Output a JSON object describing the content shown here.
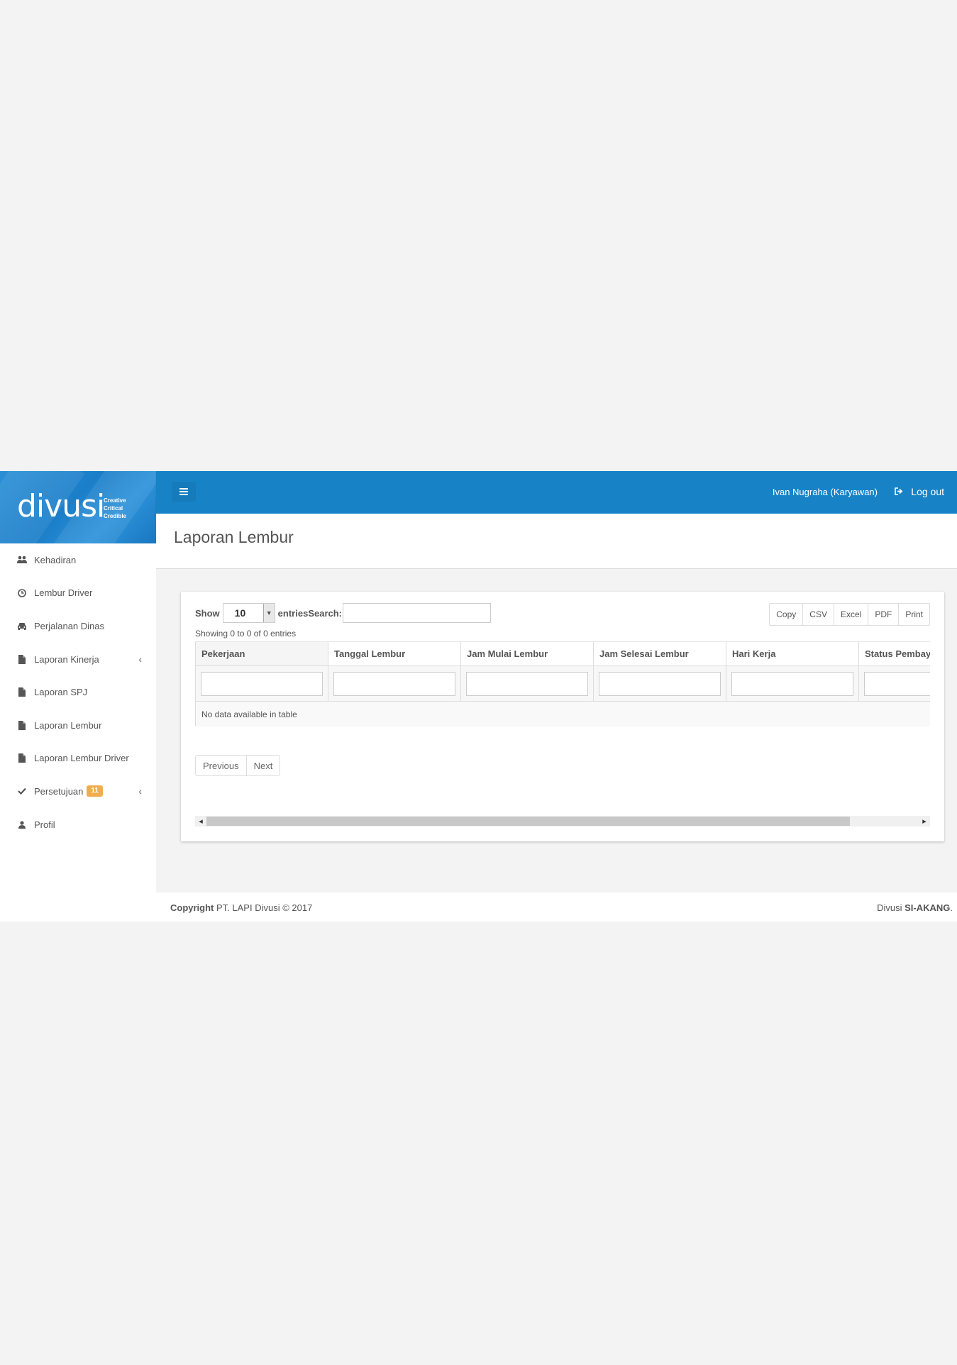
{
  "brand": {
    "logo_text": "divusi",
    "tagline": [
      "Creative",
      "Critical",
      "Credible"
    ]
  },
  "header": {
    "user_label": "Ivan Nugraha (Karyawan)",
    "logout_label": "Log out"
  },
  "sidebar": {
    "items": [
      {
        "label": "Kehadiran",
        "icon": "users-icon"
      },
      {
        "label": "Lembur Driver",
        "icon": "clock-icon"
      },
      {
        "label": "Perjalanan Dinas",
        "icon": "car-icon"
      },
      {
        "label": "Laporan Kinerja",
        "icon": "file-icon"
      },
      {
        "label": "Laporan SPJ",
        "icon": "file-icon"
      },
      {
        "label": "Laporan Lembur",
        "icon": "file-icon"
      },
      {
        "label": "Laporan Lembur Driver",
        "icon": "file-icon"
      },
      {
        "label": "Persetujuan",
        "icon": "check-icon",
        "badge": "11"
      },
      {
        "label": "Profil",
        "icon": "user-icon"
      }
    ]
  },
  "page": {
    "title": "Laporan Lembur"
  },
  "table_controls": {
    "show_label": "Show",
    "length_value": "10",
    "entries_label": "entries",
    "search_label": "Search:",
    "info": "Showing 0 to 0 of 0 entries",
    "export_buttons": [
      "Copy",
      "CSV",
      "Excel",
      "PDF",
      "Print"
    ]
  },
  "table": {
    "columns": [
      "Pekerjaan",
      "Tanggal Lembur",
      "Jam Mulai Lembur",
      "Jam Selesai Lembur",
      "Hari Kerja",
      "Status Pembayaran"
    ],
    "empty_message": "No data available in table"
  },
  "pagination": {
    "previous": "Previous",
    "next": "Next"
  },
  "footer": {
    "copyright_bold": "Copyright",
    "copyright_rest": " PT. LAPI Divusi © 2017",
    "right_plain": "Divusi ",
    "right_bold": "SI-AKANG",
    "right_end": "."
  },
  "colors": {
    "primary": "#1783c6",
    "badge": "#f0ad4e"
  }
}
